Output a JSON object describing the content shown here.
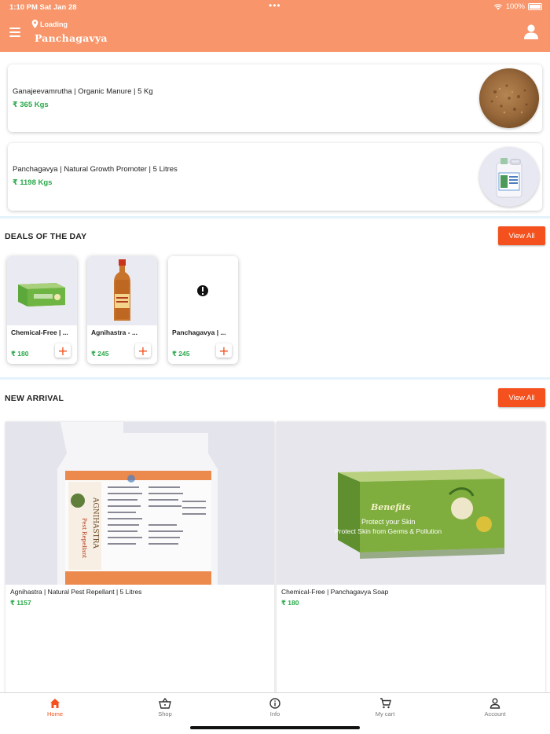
{
  "status_bar": {
    "time": "1:10 PM  Sat Jan 28",
    "dots": "•••",
    "battery": "100%"
  },
  "header": {
    "location": "Loading",
    "title": "Panchagavya"
  },
  "products": [
    {
      "name": "Ganajeevamrutha | Organic Manure | 5 Kg",
      "price": "₹ 365  Kgs"
    },
    {
      "name": "Panchagavya | Natural Growth Promoter | 5 Litres",
      "price": "₹ 1198  Kgs"
    }
  ],
  "deals": {
    "title": "DEALS OF THE DAY",
    "view_all": "View All",
    "add_symbol": "+",
    "items": [
      {
        "name": "Chemical-Free | ...",
        "price": "₹ 180"
      },
      {
        "name": "Agnihastra - ...",
        "price": "₹ 245"
      },
      {
        "name": "Panchagavya | ...",
        "price": "₹ 245"
      }
    ]
  },
  "new_arrival": {
    "title": "NEW ARRIVAL",
    "view_all": "View All",
    "items": [
      {
        "name": "Agnihastra | Natural Pest Repellant | 5 Litres",
        "price": "₹ 1157",
        "label_text": "AGNIHASTRA",
        "label_sub": "Pest Repellant"
      },
      {
        "name": "Chemical-Free | Panchagavya Soap",
        "price": "₹ 180",
        "box_brand": "Benefits",
        "box_line1": "Protect your Skin",
        "box_line2": "Protect Skin from Germs & Pollution"
      }
    ]
  },
  "bottom_nav": [
    {
      "label": "Home",
      "icon": "home-icon",
      "active": true
    },
    {
      "label": "Shop",
      "icon": "basket-icon",
      "active": false
    },
    {
      "label": "Info",
      "icon": "info-icon",
      "active": false
    },
    {
      "label": "My cart",
      "icon": "cart-icon",
      "active": false
    },
    {
      "label": "Account",
      "icon": "account-icon",
      "active": false
    }
  ],
  "colors": {
    "header": "#f8956a",
    "accent": "#f4511e",
    "price": "#2aa84a"
  }
}
